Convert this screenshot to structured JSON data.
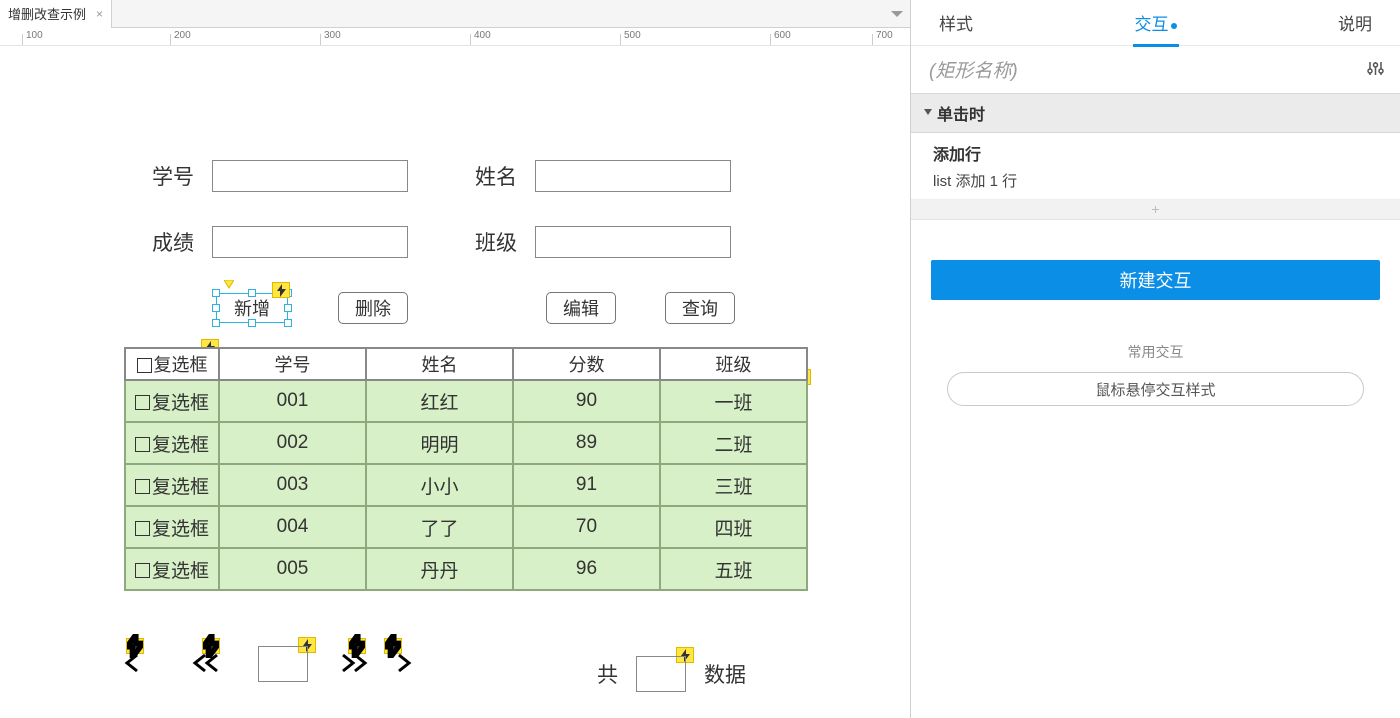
{
  "tab": {
    "title": "增删改查示例",
    "close": "×"
  },
  "ruler": [
    100,
    200,
    300,
    400,
    500,
    600,
    700
  ],
  "form": {
    "label_id": "学号",
    "label_name": "姓名",
    "label_score": "成绩",
    "label_class": "班级"
  },
  "buttons": {
    "add": "新增",
    "delete": "删除",
    "edit": "编辑",
    "query": "查询"
  },
  "table": {
    "header": {
      "check": "复选框",
      "id": "学号",
      "name": "姓名",
      "score": "分数",
      "class": "班级"
    },
    "rows": [
      {
        "check": "复选框",
        "id": "001",
        "name": "红红",
        "score": "90",
        "class": "一班"
      },
      {
        "check": "复选框",
        "id": "002",
        "name": "明明",
        "score": "89",
        "class": "二班"
      },
      {
        "check": "复选框",
        "id": "003",
        "name": "小小",
        "score": "91",
        "class": "三班"
      },
      {
        "check": "复选框",
        "id": "004",
        "name": "了了",
        "score": "70",
        "class": "四班"
      },
      {
        "check": "复选框",
        "id": "005",
        "name": "丹丹",
        "score": "96",
        "class": "五班"
      }
    ]
  },
  "pager": {
    "total_prefix": "共",
    "total_suffix": "数据"
  },
  "inspector": {
    "tabs": {
      "style": "样式",
      "interactions": "交互",
      "notes": "说明"
    },
    "name_placeholder": "(矩形名称)",
    "event": {
      "title": "单击时",
      "action_title": "添加行",
      "action_desc": "list 添加 1 行"
    },
    "add_placeholder": "+",
    "new_interaction": "新建交互",
    "common_label": "常用交互",
    "hover_style": "鼠标悬停交互样式"
  }
}
